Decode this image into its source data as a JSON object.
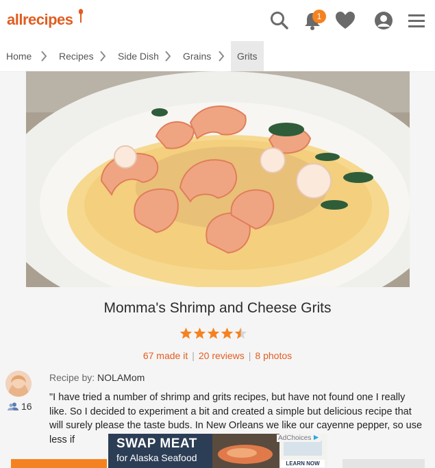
{
  "header": {
    "logo": "allrecipes",
    "notification_count": "1",
    "icons": [
      "search-icon",
      "bell-icon",
      "heart-icon",
      "profile-icon",
      "menu-icon"
    ]
  },
  "breadcrumb": [
    "Home",
    "Recipes",
    "Side Dish",
    "Grains",
    "Grits"
  ],
  "recipe": {
    "title": "Momma's Shrimp and Cheese Grits",
    "rating": 4.5,
    "made_it": "67 made it",
    "reviews": "20 reviews",
    "photos": "8 photos",
    "byline_label": "Recipe by:",
    "author": "NOLAMom",
    "followers": "16",
    "description": "\"I have tried a number of shrimp and grits recipes, but have not found one I really like. So I decided to experiment a bit and created a simple but delicious recipe that will surely please the taste buds. In New Orleans we like our cayenne pepper, so use less if"
  },
  "ad": {
    "headline": "SWAP MEAT",
    "subline": "for Alaska Seafood",
    "choices": "AdChoices",
    "cta": "LEARN NOW"
  },
  "colors": {
    "brand": "#e15d20",
    "star": "#f58220",
    "badge": "#f58220"
  }
}
